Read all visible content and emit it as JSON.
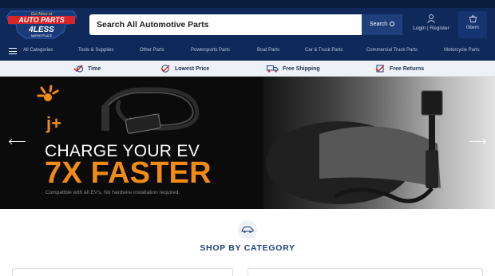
{
  "logo": {
    "tag": "Get More at",
    "line1": "AUTO PARTS",
    "line2": "4LESS",
    "line3": "MARKETPLACE"
  },
  "search": {
    "placeholder": "Search All Automotive Parts",
    "button_label": "Search",
    "icon": "search-icon"
  },
  "account": {
    "login": "Login",
    "separator": "|",
    "register": "Register",
    "icon": "user-icon"
  },
  "cart": {
    "label": "0item",
    "icon": "cart-icon"
  },
  "nav": {
    "menu_icon": "hamburger-icon",
    "items": [
      "All Categories",
      "Tools & Supplies",
      "Other Parts",
      "Powersports Parts",
      "Boat Parts",
      "Car & Truck Parts",
      "Commercial Truck Parts",
      "Motorcycle Parts"
    ]
  },
  "features": [
    {
      "label": "Time",
      "icon": "check-clock-icon"
    },
    {
      "label": "Lowest Price",
      "icon": "dollar-tag-icon"
    },
    {
      "label": "Free Shipping",
      "icon": "truck-icon"
    },
    {
      "label": "Free Returns",
      "icon": "return-icon"
    }
  ],
  "hero": {
    "brand": "j+",
    "title_line1": "CHARGE YOUR EV",
    "title_line2": "7X FASTER",
    "subtitle": "Compatible with all EV's. No hardwire installation required.",
    "prev_icon": "arrow-left-icon",
    "next_icon": "arrow-right-icon"
  },
  "category": {
    "icon": "car-icon",
    "title": "SHOP BY CATEGORY"
  },
  "colors": {
    "navy": "#0f2a5a",
    "button_blue": "#1e3f7c",
    "accent_orange": "#f28b14",
    "logo_red": "#d8242b"
  }
}
